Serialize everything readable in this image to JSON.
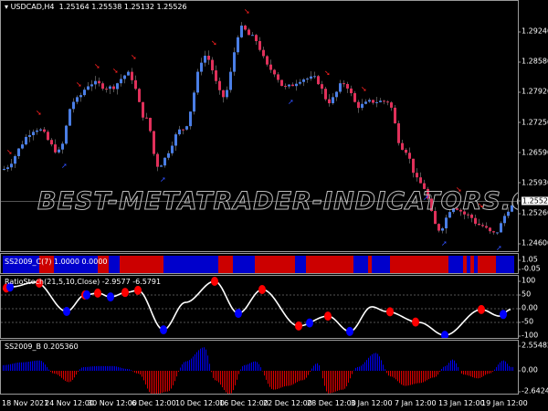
{
  "main": {
    "title": "USDCAD,H4",
    "ohlc": "1.25164 1.25538 1.25132 1.25526",
    "watermark": "BEST-METATRADER-INDICATORS.COM",
    "price_ticks": [
      "1.29240",
      "1.28580",
      "1.27920",
      "1.27250",
      "1.26590",
      "1.25930",
      "1.25260",
      "1.24600"
    ],
    "current_price": "1.25526",
    "colors": {
      "bull": "#4a7ee6",
      "bear": "#e0305a",
      "up_arrow": "#3050ff",
      "down_arrow": "#ff2020"
    },
    "price_path": [
      [
        0,
        1.2622
      ],
      [
        10,
        1.2712
      ],
      [
        16,
        1.2662
      ],
      [
        20,
        1.2772
      ],
      [
        25,
        1.2812
      ],
      [
        30,
        1.2802
      ],
      [
        35,
        1.2832
      ],
      [
        40,
        1.2732
      ],
      [
        43,
        1.2632
      ],
      [
        50,
        1.2712
      ],
      [
        56,
        1.2872
      ],
      [
        61,
        1.2782
      ],
      [
        66,
        1.2932
      ],
      [
        69,
        1.2912
      ],
      [
        74,
        1.2842
      ],
      [
        78,
        1.2802
      ],
      [
        83,
        1.2822
      ],
      [
        86,
        1.2822
      ],
      [
        90,
        1.2772
      ],
      [
        94,
        1.2812
      ],
      [
        98,
        1.2762
      ],
      [
        102,
        1.2772
      ],
      [
        106,
        1.2772
      ],
      [
        110,
        1.2672
      ],
      [
        115,
        1.2592
      ],
      [
        120,
        1.2492
      ],
      [
        124,
        1.2542
      ],
      [
        128,
        1.2522
      ],
      [
        131,
        1.2502
      ],
      [
        135,
        1.2482
      ],
      [
        140,
        1.2542
      ]
    ],
    "signals": [
      {
        "i": 1,
        "type": "down"
      },
      {
        "i": 9,
        "type": "down"
      },
      {
        "i": 16,
        "type": "up"
      },
      {
        "i": 20,
        "type": "down"
      },
      {
        "i": 25,
        "type": "down"
      },
      {
        "i": 30,
        "type": "down"
      },
      {
        "i": 35,
        "type": "down"
      },
      {
        "i": 43,
        "type": "up"
      },
      {
        "i": 57,
        "type": "down"
      },
      {
        "i": 66,
        "type": "down"
      },
      {
        "i": 78,
        "type": "up"
      },
      {
        "i": 88,
        "type": "down"
      },
      {
        "i": 98,
        "type": "down"
      },
      {
        "i": 115,
        "type": "up"
      },
      {
        "i": 120,
        "type": "up"
      },
      {
        "i": 124,
        "type": "down"
      },
      {
        "i": 130,
        "type": "down"
      },
      {
        "i": 135,
        "type": "up"
      }
    ]
  },
  "ss_c": {
    "title": "SS2009_C(7) 1.0000 0.0000",
    "ticks": [
      "1.05",
      "-0.05"
    ],
    "colors": {
      "on": "#cc0000",
      "off": "#0000cc"
    },
    "red_segments": [
      [
        10,
        14
      ],
      [
        26,
        29
      ],
      [
        32,
        44
      ],
      [
        59,
        63
      ],
      [
        69,
        80
      ],
      [
        83,
        86
      ],
      [
        86,
        96
      ],
      [
        100,
        101
      ],
      [
        106,
        122
      ],
      [
        126,
        127
      ],
      [
        128,
        129
      ],
      [
        130,
        135
      ]
    ]
  },
  "stoch": {
    "title": "RatioStoch(21,5,10,Close) -2.9577 -6.5791",
    "ticks": [
      "100",
      "50",
      "0.00",
      "-50",
      "-100"
    ],
    "range": [
      -100,
      100
    ],
    "path": [
      [
        0,
        73
      ],
      [
        2.5,
        80
      ],
      [
        9,
        97
      ],
      [
        17.5,
        -10
      ],
      [
        22.5,
        50
      ],
      [
        26,
        57
      ],
      [
        29.5,
        43
      ],
      [
        34,
        60
      ],
      [
        37,
        67
      ],
      [
        44,
        -77
      ],
      [
        50,
        23
      ],
      [
        58,
        100
      ],
      [
        64.5,
        -17
      ],
      [
        71,
        70
      ],
      [
        81,
        -63
      ],
      [
        89,
        -27
      ],
      [
        95,
        -83
      ],
      [
        101,
        7
      ],
      [
        105,
        -10
      ],
      [
        114,
        -50
      ],
      [
        121,
        -97
      ],
      [
        131,
        -3
      ],
      [
        136,
        -27
      ],
      [
        139,
        -3
      ]
    ],
    "dots": [
      {
        "i": 1,
        "c": "red"
      },
      {
        "i": 2,
        "c": "blue"
      },
      {
        "i": 10,
        "c": "red"
      },
      {
        "i": 17.5,
        "c": "blue"
      },
      {
        "i": 22.5,
        "c": "red"
      },
      {
        "i": 23,
        "c": "blue"
      },
      {
        "i": 26,
        "c": "red"
      },
      {
        "i": 29.5,
        "c": "blue"
      },
      {
        "i": 33.5,
        "c": "red"
      },
      {
        "i": 37,
        "c": "red"
      },
      {
        "i": 44,
        "c": "blue"
      },
      {
        "i": 58,
        "c": "red"
      },
      {
        "i": 64.5,
        "c": "blue"
      },
      {
        "i": 71,
        "c": "red"
      },
      {
        "i": 81,
        "c": "red"
      },
      {
        "i": 84,
        "c": "blue"
      },
      {
        "i": 89,
        "c": "red"
      },
      {
        "i": 95,
        "c": "blue"
      },
      {
        "i": 106,
        "c": "red"
      },
      {
        "i": 113,
        "c": "red"
      },
      {
        "i": 121,
        "c": "blue"
      },
      {
        "i": 131,
        "c": "red"
      },
      {
        "i": 137,
        "c": "blue"
      }
    ]
  },
  "ss_b": {
    "title": "SS2009_B 0.205360",
    "ticks": [
      "2.554822",
      "0.00",
      "-2.6424"
    ],
    "range": [
      -2.6424,
      2.554822
    ],
    "path": [
      [
        0,
        0.6
      ],
      [
        5,
        0.9
      ],
      [
        10,
        1.1
      ],
      [
        14,
        -0.3
      ],
      [
        18,
        -1.2
      ],
      [
        22,
        0.4
      ],
      [
        26,
        0.5
      ],
      [
        30,
        0.5
      ],
      [
        34,
        0.2
      ],
      [
        37,
        -0.3
      ],
      [
        41,
        -2.6
      ],
      [
        45,
        -2.2
      ],
      [
        50,
        1.0
      ],
      [
        55,
        2.5
      ],
      [
        58,
        -1.0
      ],
      [
        62,
        -2.5
      ],
      [
        66,
        0.6
      ],
      [
        69,
        1.0
      ],
      [
        74,
        -2.0
      ],
      [
        78,
        -1.6
      ],
      [
        82,
        -1.0
      ],
      [
        86,
        0.8
      ],
      [
        89,
        -2.4
      ],
      [
        93,
        -2.0
      ],
      [
        97,
        0.4
      ],
      [
        102,
        1.9
      ],
      [
        106,
        -0.6
      ],
      [
        110,
        -1.6
      ],
      [
        114,
        -1.3
      ],
      [
        118,
        -0.7
      ],
      [
        121,
        0.5
      ],
      [
        123,
        1.2
      ],
      [
        126,
        -0.4
      ],
      [
        130,
        -0.8
      ],
      [
        133,
        -0.3
      ],
      [
        137,
        1.1
      ],
      [
        139,
        0.4
      ]
    ]
  },
  "time_axis": [
    "18 Nov 2021",
    "24 Nov 12:00",
    "30 Nov 12:00",
    "6 Dec 12:00",
    "10 Dec 12:00",
    "16 Dec 12:00",
    "22 Dec 12:00",
    "28 Dec 12:00",
    "3 Jan 12:00",
    "7 Jan 12:00",
    "13 Jan 12:00",
    "19 Jan 12:00"
  ]
}
